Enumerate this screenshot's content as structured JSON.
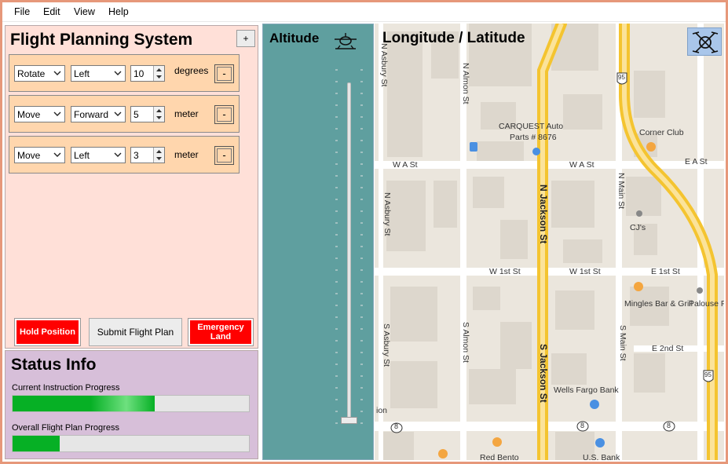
{
  "menu": [
    "File",
    "Edit",
    "View",
    "Help"
  ],
  "planning": {
    "title": "Flight Planning System",
    "add_label": "+",
    "instructions": [
      {
        "action": "Rotate",
        "direction": "Left",
        "amount": "10",
        "unit": "degrees",
        "remove_label": "-"
      },
      {
        "action": "Move",
        "direction": "Forward",
        "amount": "5",
        "unit": "meter",
        "remove_label": "-"
      },
      {
        "action": "Move",
        "direction": "Left",
        "amount": "3",
        "unit": "meter",
        "remove_label": "-"
      }
    ],
    "hold_label": "Hold Position",
    "submit_label": "Submit Flight Plan",
    "emergency_label_line1": "Emergency",
    "emergency_label_line2": "Land"
  },
  "status": {
    "title": "Status Info",
    "current_label": "Current Instruction Progress",
    "current_progress": 0.6,
    "overall_label": "Overall Flight Plan Progress",
    "overall_progress": 0.2
  },
  "altitude": {
    "title": "Altitude",
    "value_fraction": 0.0
  },
  "map": {
    "title": "Longitude / Latitude",
    "labels": {
      "n_asbury_top": "N Asbury St",
      "n_almon": "N Almon St",
      "carquest1": "CARQUEST Auto",
      "carquest2": "Parts # 8676",
      "corner_club": "Corner Club",
      "wa_st_left": "W A St",
      "wa_st_right": "W A St",
      "ea_st": "E A St",
      "n_asbury_mid": "N Asbury St",
      "n_jackson": "N Jackson St",
      "n_main": "N Main St",
      "cjs": "CJ's",
      "w1st_left": "W 1st St",
      "w1st_right": "W 1st St",
      "e1st": "E 1st St",
      "mingles": "Mingles Bar & Grill",
      "palouse": "Palouse Pr",
      "s_asbury": "S Asbury St",
      "s_almon": "S Almon St",
      "s_jackson": "S Jackson St",
      "s_main": "S Main St",
      "e2nd": "E 2nd St",
      "wells": "Wells Fargo Bank",
      "ion": "ion",
      "red_bento": "Red Bento",
      "us_bank": "U.S. Bank",
      "hw95": "95",
      "route8": "8"
    }
  }
}
